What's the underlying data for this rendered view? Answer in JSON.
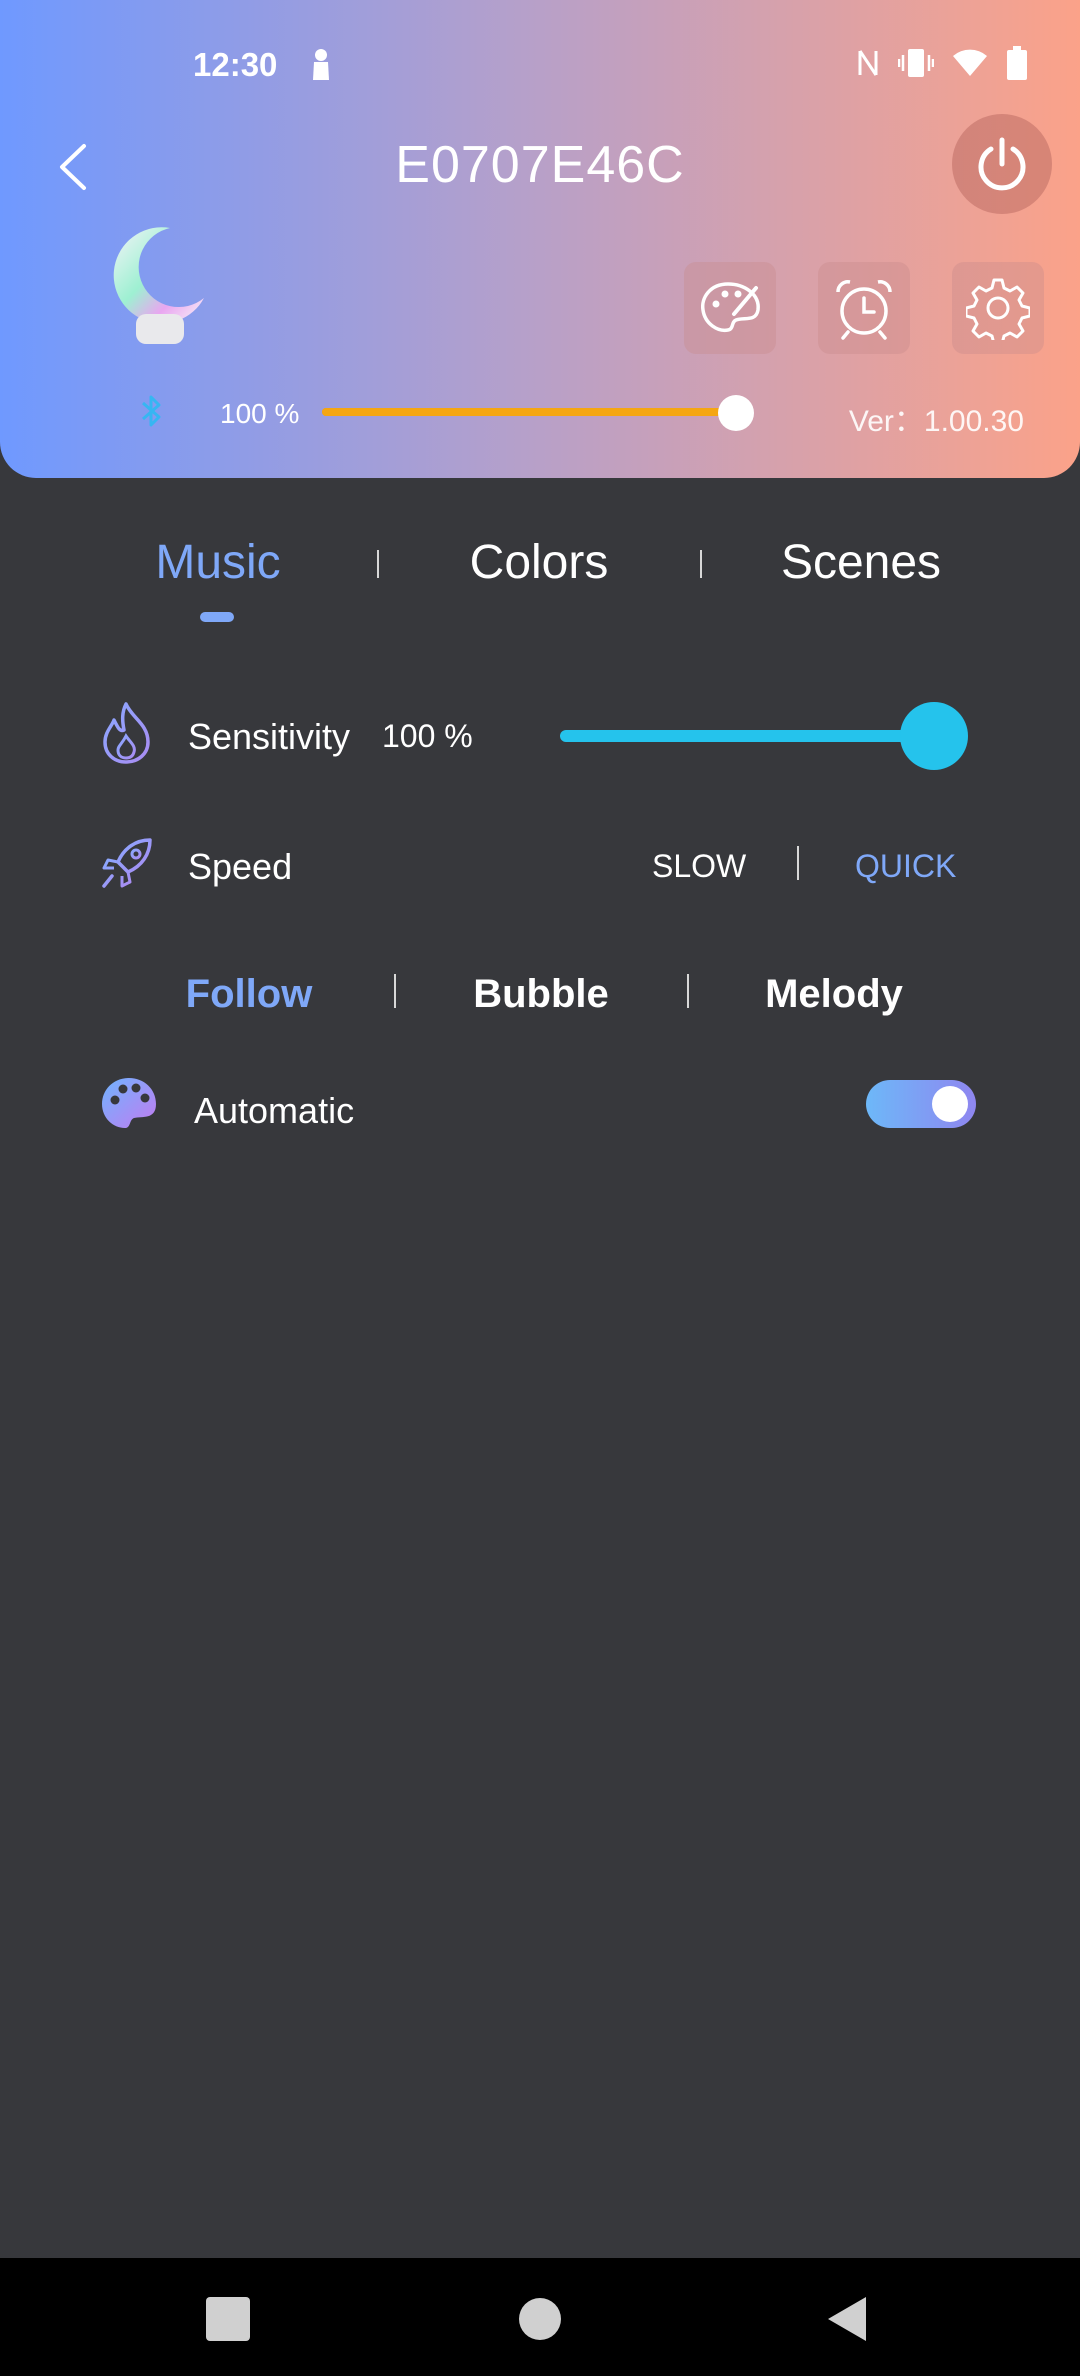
{
  "status_bar": {
    "time": "12:30",
    "icons": [
      "person-icon",
      "nfc-icon",
      "vibrate-icon",
      "wifi-icon",
      "battery-icon"
    ]
  },
  "header": {
    "title": "E0707E46C",
    "brightness_label": "100 %",
    "brightness_value": 1.0,
    "version": "Ver：1.00.30",
    "tools": [
      "palette-icon",
      "alarm-clock-icon",
      "settings-gear-icon"
    ]
  },
  "tabs": {
    "items": [
      "Music",
      "Colors",
      "Scenes"
    ],
    "active": "Music"
  },
  "music": {
    "sensitivity": {
      "label": "Sensitivity",
      "value_text": "100 %",
      "value": 1.0
    },
    "speed": {
      "label": "Speed",
      "options": [
        "SLOW",
        "QUICK"
      ],
      "selected": "QUICK"
    },
    "modes": {
      "items": [
        "Follow",
        "Bubble",
        "Melody"
      ],
      "active": "Follow"
    },
    "automatic": {
      "label": "Automatic",
      "enabled": true
    }
  },
  "colors": {
    "gradient_start": "#6f99ff",
    "gradient_end": "#fba289",
    "accent_blue": "#7fa8f8",
    "slider_cyan": "#25c3ec",
    "brightness_orange": "#f5a612",
    "background": "#37383c"
  }
}
